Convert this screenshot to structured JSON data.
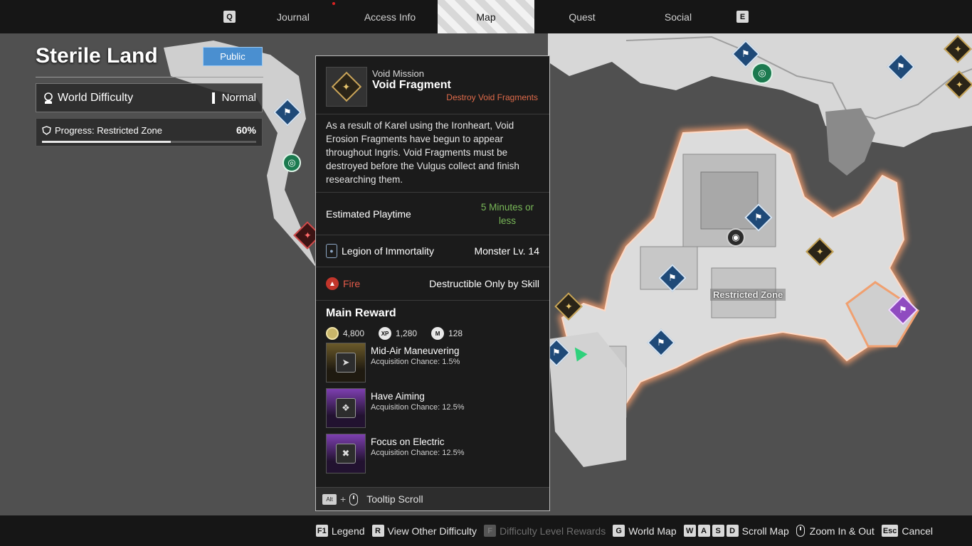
{
  "nav": {
    "left_key": "Q",
    "right_key": "E",
    "tabs": [
      {
        "label": "Journal"
      },
      {
        "label": "Access Info"
      },
      {
        "label": "Map",
        "active": true
      },
      {
        "label": "Quest"
      },
      {
        "label": "Social"
      }
    ]
  },
  "region": {
    "title": "Sterile Land",
    "badge": "Public",
    "difficulty_label": "World Difficulty",
    "difficulty_value": "Normal",
    "progress_label": "Progress: Restricted Zone",
    "progress_value": "60%",
    "progress_fraction": 0.6
  },
  "map": {
    "zone_label": "Restricted Zone"
  },
  "tooltip": {
    "mission_type": "Void Mission",
    "mission_name": "Void Fragment",
    "mission_subtitle": "Destroy Void Fragments",
    "description": "As a result of Karel using the Ironheart, Void Erosion Fragments have begun to appear throughout Ingris. Void Fragments must be destroyed before the Vulgus collect and finish researching them.",
    "playtime_label": "Estimated Playtime",
    "playtime_value": "5 Minutes or less",
    "legion_label": "Legion of Immortality",
    "legion_value": "Monster Lv. 14",
    "element_label": "Fire",
    "element_value": "Destructible Only by Skill",
    "reward_title": "Main Reward",
    "currencies": [
      {
        "icon": "gold-coin-icon",
        "value": "4,800"
      },
      {
        "icon": "character-exp-icon",
        "value": "1,280"
      },
      {
        "icon": "mastery-exp-icon",
        "value": "128"
      }
    ],
    "rewards": [
      {
        "name": "Mid-Air Maneuvering",
        "chance": "Acquisition Chance: 1.5%",
        "rarity": "gold"
      },
      {
        "name": "Have Aiming",
        "chance": "Acquisition Chance: 12.5%",
        "rarity": "purple"
      },
      {
        "name": "Focus on Electric",
        "chance": "Acquisition Chance: 12.5%",
        "rarity": "purple"
      }
    ],
    "footer_key": "Alt",
    "footer_label": "Tooltip Scroll"
  },
  "bottom_bar": {
    "legend": {
      "key": "F1",
      "label": "Legend"
    },
    "other_difficulty": {
      "key": "R",
      "label": "View Other Difficulty"
    },
    "difficulty_rewards": {
      "key": "F",
      "label": "Difficulty Level Rewards"
    },
    "world_map": {
      "key": "G",
      "label": "World Map"
    },
    "scroll_map": {
      "keys": [
        "W",
        "A",
        "S",
        "D"
      ],
      "label": "Scroll Map"
    },
    "zoom": {
      "label": "Zoom In & Out"
    },
    "cancel": {
      "key": "Esc",
      "label": "Cancel"
    }
  },
  "colors": {
    "accent_blue": "#4a8fd0",
    "playtime_green": "#79b858",
    "fire_red": "#e45b4a",
    "subtitle_orange": "#e06b4a",
    "zone_border": "#f0a070"
  }
}
